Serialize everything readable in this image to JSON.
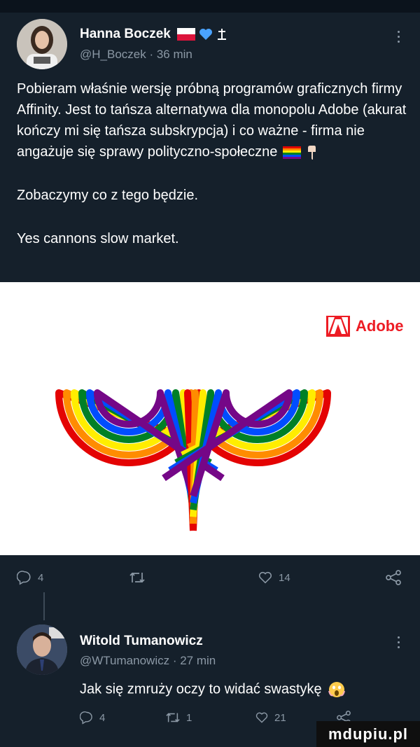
{
  "tweet": {
    "author_name": "Hanna Boczek",
    "handle_time": "@H_Boczek · 36 min",
    "paragraphs": [
      "Pobieram właśnie wersję próbną programów graficznych firmy Affinity. Jest to tańsza alternatywa dla monopolu Adobe (akurat kończy mi się tańsza subskrypcja) i co ważne - firma nie angażuje się sprawy polityczno-społeczne",
      "Zobaczymy co z tego będzie.",
      "Yes cannons slow market."
    ],
    "media": {
      "brand_label": "Adobe",
      "rainbow_colors": [
        "#e40303",
        "#ff8c00",
        "#ffed00",
        "#008026",
        "#004dff",
        "#750787"
      ]
    },
    "actions": {
      "reply_count": "4",
      "retweet_count": "",
      "like_count": "14"
    }
  },
  "reply": {
    "author_name": "Witold Tumanowicz",
    "handle_time": "@WTumanowicz · 27 min",
    "text": "Jak się zmruży oczy to widać swastykę",
    "actions": {
      "reply_count": "4",
      "retweet_count": "1",
      "like_count": "21"
    }
  },
  "watermark": "mdupiu.pl",
  "icons": [
    "reply-icon",
    "retweet-icon",
    "like-icon",
    "share-icon",
    "more-icon",
    "poland-flag-icon",
    "blue-heart-icon",
    "rainbow-flag-icon",
    "hand-icon",
    "screaming-face-icon"
  ]
}
